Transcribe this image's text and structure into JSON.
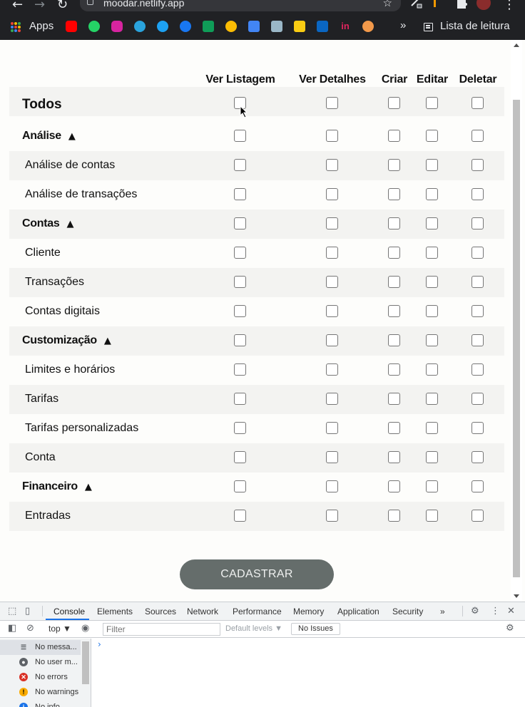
{
  "browser": {
    "url": "moodar.netlify.app",
    "apps_label": "Apps",
    "more_label": "»",
    "reading_list_label": "Lista de leitura"
  },
  "table": {
    "columns": [
      "Ver Listagem",
      "Ver Detalhes",
      "Criar",
      "Editar",
      "Deletar"
    ],
    "all_label": "Todos",
    "rows": [
      {
        "label": "Análise",
        "type": "group"
      },
      {
        "label": "Análise de contas",
        "type": "child"
      },
      {
        "label": "Análise de transações",
        "type": "child"
      },
      {
        "label": "Contas",
        "type": "group"
      },
      {
        "label": "Cliente",
        "type": "child"
      },
      {
        "label": "Transações",
        "type": "child"
      },
      {
        "label": "Contas digitais",
        "type": "child"
      },
      {
        "label": "Customização",
        "type": "group"
      },
      {
        "label": "Limites e horários",
        "type": "child"
      },
      {
        "label": "Tarifas",
        "type": "child"
      },
      {
        "label": "Tarifas personalizadas",
        "type": "child"
      },
      {
        "label": "Conta",
        "type": "child"
      },
      {
        "label": "Financeiro",
        "type": "group"
      },
      {
        "label": "Entradas",
        "type": "child"
      }
    ],
    "caret": "▲",
    "submit_label": "CADASTRAR"
  },
  "devtools": {
    "tabs": [
      "Console",
      "Elements",
      "Sources",
      "Network",
      "Performance",
      "Memory",
      "Application",
      "Security"
    ],
    "more_tabs": "»",
    "context": "top ▼",
    "filter_placeholder": "Filter",
    "levels": "Default levels ▼",
    "issues": "No Issues",
    "sidebar": [
      {
        "label": "No messa...",
        "icon": "list-icon"
      },
      {
        "label": "No user m...",
        "icon": "user-icon"
      },
      {
        "label": "No errors",
        "icon": "error-icon"
      },
      {
        "label": "No warnings",
        "icon": "warning-icon"
      },
      {
        "label": "No info",
        "icon": "info-icon"
      }
    ],
    "prompt": "›"
  }
}
